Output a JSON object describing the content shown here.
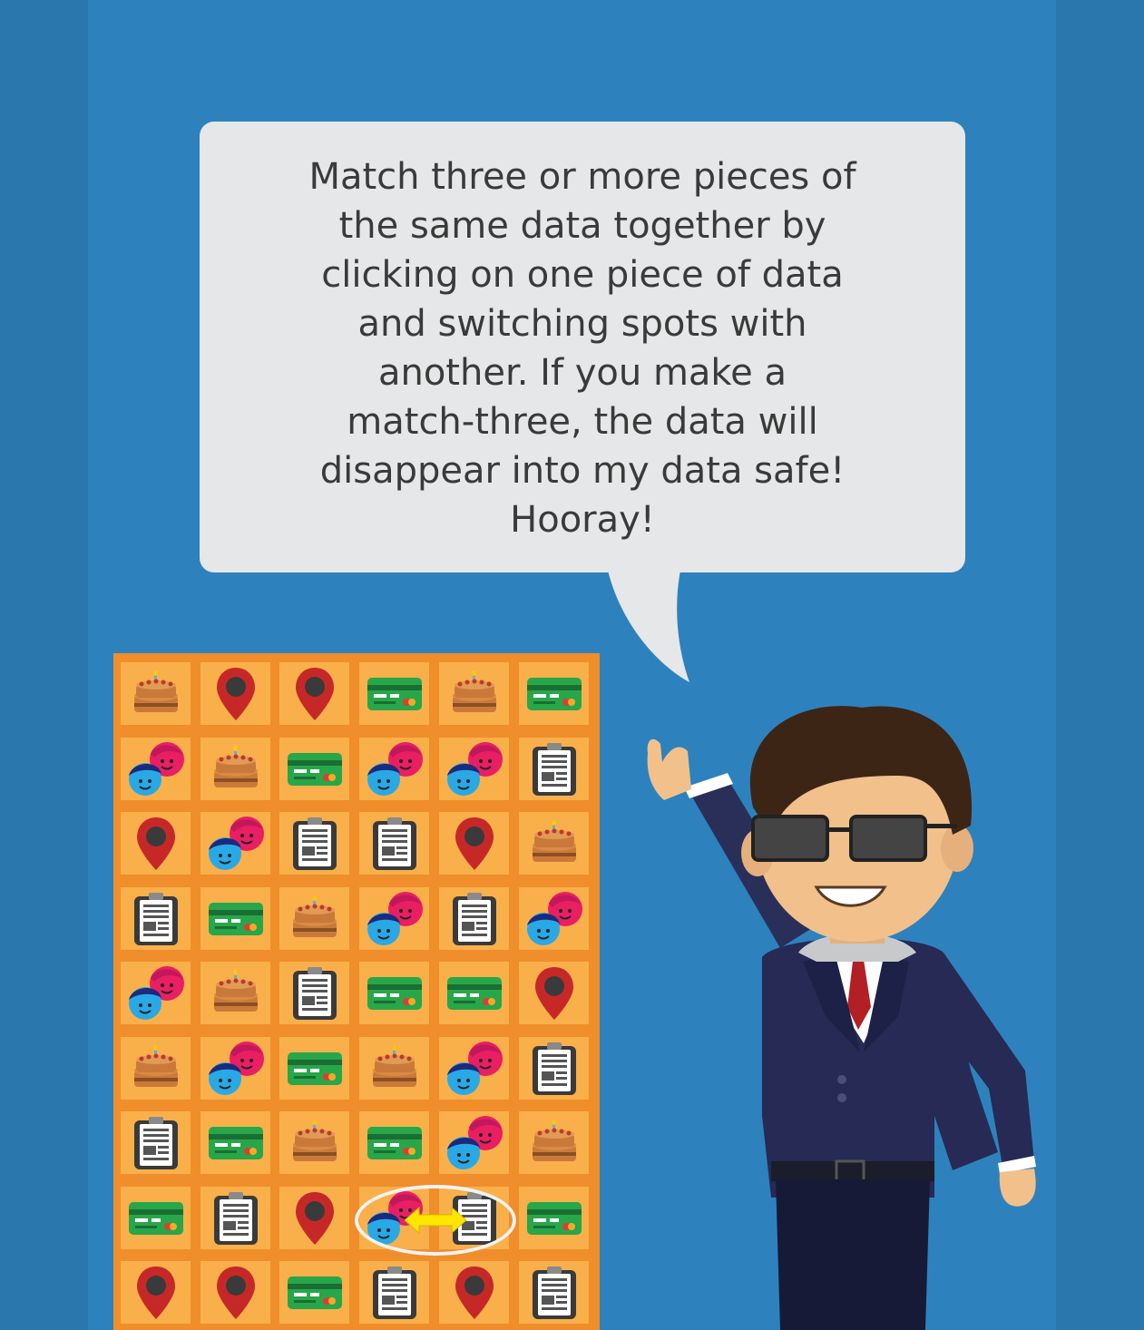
{
  "speech_bubble": {
    "lines": [
      "Match three or more pieces of",
      "the same data together by",
      "clicking on one piece of data",
      "and switching spots with",
      "another. If you make a",
      "match-three, the data will",
      "disappear into my data safe!",
      "Hooray!"
    ]
  },
  "board": {
    "columns": 6,
    "rows": 9,
    "visible_cells": [
      [
        "cake-icon",
        "location-pin-icon",
        "location-pin-icon",
        "credit-card-icon",
        "cake-icon",
        "credit-card-icon"
      ],
      [
        "people-icon",
        "cake-icon",
        "credit-card-icon",
        "people-icon",
        "people-icon",
        "document-icon"
      ],
      [
        "location-pin-icon",
        "people-icon",
        "document-icon",
        "document-icon",
        "location-pin-icon",
        "cake-icon"
      ],
      [
        "document-icon",
        "credit-card-icon",
        "cake-icon",
        "people-icon",
        "document-icon",
        "people-icon"
      ],
      [
        "people-icon",
        "cake-icon",
        "document-icon",
        "credit-card-icon",
        "credit-card-icon",
        "location-pin-icon"
      ],
      [
        "cake-icon",
        "people-icon",
        "credit-card-icon",
        "cake-icon",
        "people-icon",
        "document-icon"
      ],
      [
        "document-icon",
        "credit-card-icon",
        "cake-icon",
        "credit-card-icon",
        "people-icon",
        "cake-icon"
      ],
      [
        "credit-card-icon",
        "document-icon",
        "location-pin-icon",
        "people-icon",
        "document-icon",
        "credit-card-icon"
      ],
      [
        "location-pin-icon",
        "location-pin-icon",
        "credit-card-icon",
        "document-icon",
        "location-pin-icon",
        "document-icon"
      ]
    ],
    "swap_hint": {
      "row": 7,
      "from_col": 3,
      "to_col": 4,
      "icon": "double-arrow-icon"
    }
  },
  "colors": {
    "background": "#2d82bd",
    "board_frame": "#ef8e2a",
    "cell": "#f9b04a",
    "bubble": "#e6e7e8",
    "text": "#3a3a3a",
    "arrow": "#ffe500"
  }
}
